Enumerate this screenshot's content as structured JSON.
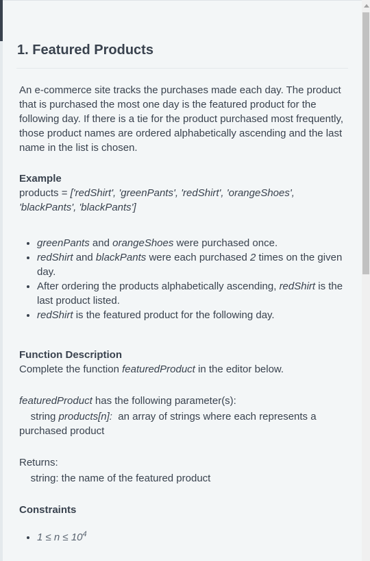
{
  "title": "1. Featured Products",
  "intro": "An e-commerce site tracks the purchases made each day. The product that is purchased the most one day is the featured product for the following day. If there is a tie for the product purchased most frequently, those product names are ordered alphabetically ascending and the last name in the list is chosen.",
  "example": {
    "heading": "Example",
    "prefix": "products = ",
    "value": "['redShirt', 'greenPants', 'redShirt', 'orangeShoes', 'blackPants', 'blackPants']",
    "bullets": [
      {
        "a": "greenPants",
        "b": " and ",
        "c": "orangeShoes",
        "d": " were purchased once."
      },
      {
        "a": "redShirt",
        "b": " and ",
        "c": "blackPants",
        "d": " were each purchased ",
        "e": "2",
        "f": " times on the given day."
      },
      {
        "a": "After ordering the products alphabetically ascending, ",
        "b": "redShirt",
        "c": " is the last product listed."
      },
      {
        "a": "redShirt",
        "b": " is the featured product for the following day."
      }
    ]
  },
  "function_description": {
    "heading": "Function Description",
    "pre": "Complete the function ",
    "name": "featuredProduct",
    "post": " in the editor below.",
    "params_intro": " has the following parameter(s):",
    "param_type": "string ",
    "param_name": "products[n]:",
    "param_desc": "  an array of strings where each represents a purchased product",
    "returns_label": "Returns:",
    "returns_desc": "string: the name of the featured product"
  },
  "constraints": {
    "heading": "Constraints",
    "items": [
      {
        "lhs": "1 ≤ n ≤ 10",
        "sup": "4"
      }
    ]
  }
}
